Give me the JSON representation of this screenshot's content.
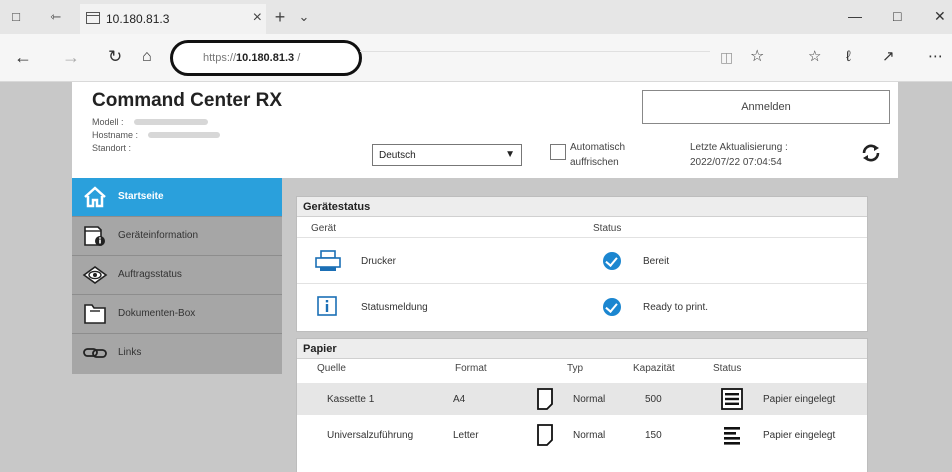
{
  "browser": {
    "tab_title": "10.180.81.3",
    "url_prefix": "https://",
    "url_host": "10.180.81.3",
    "url_suffix": " /"
  },
  "header": {
    "title": "Command Center RX",
    "model_label": "Modell :",
    "hostname_label": "Hostname :",
    "location_label": "Standort :",
    "language": "Deutsch",
    "auto_refresh_line1": "Automatisch",
    "auto_refresh_line2": "auffrischen",
    "login_button": "Anmelden",
    "last_update_label": "Letzte Aktualisierung :",
    "last_update_value": "2022/07/22 07:04:54"
  },
  "sidebar": {
    "items": [
      {
        "label": "Startseite",
        "icon": "home-icon"
      },
      {
        "label": "Geräteinformation",
        "icon": "device-info-icon"
      },
      {
        "label": "Auftragsstatus",
        "icon": "eye-icon"
      },
      {
        "label": "Dokumenten-Box",
        "icon": "folder-icon"
      },
      {
        "label": "Links",
        "icon": "link-icon"
      }
    ]
  },
  "device_status": {
    "title": "Gerätestatus",
    "col_device": "Gerät",
    "col_status": "Status",
    "rows": [
      {
        "device": "Drucker",
        "status": "Bereit"
      },
      {
        "device": "Statusmeldung",
        "status": "Ready to print."
      }
    ]
  },
  "paper": {
    "title": "Papier",
    "columns": [
      "Quelle",
      "Format",
      "Typ",
      "Kapazität",
      "Status"
    ],
    "rows": [
      {
        "source": "Kassette 1",
        "format": "A4",
        "type": "Normal",
        "capacity": "500",
        "status": "Papier eingelegt"
      },
      {
        "source": "Universalzuführung",
        "format": "Letter",
        "type": "Normal",
        "capacity": "150",
        "status": "Papier eingelegt"
      }
    ]
  },
  "colors": {
    "active_nav": "#2aa0dc",
    "status_check": "#1b86d0"
  }
}
